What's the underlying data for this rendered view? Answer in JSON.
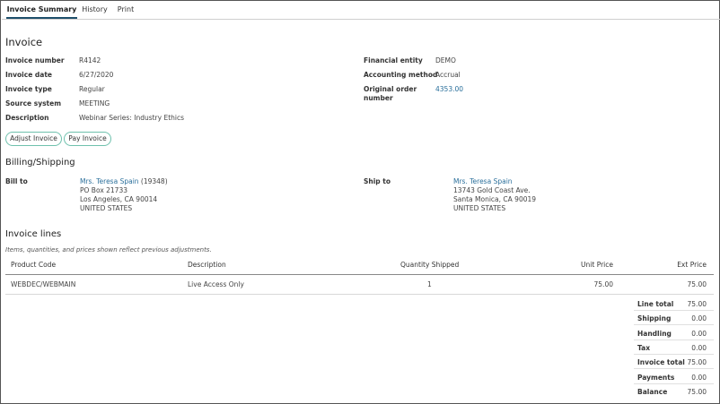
{
  "tabs": [
    "Invoice Summary",
    "History",
    "Print"
  ],
  "invoice": {
    "heading": "Invoice",
    "left": [
      {
        "label": "Invoice number",
        "value": "R4142"
      },
      {
        "label": "Invoice date",
        "value": "6/27/2020"
      },
      {
        "label": "Invoice type",
        "value": "Regular"
      },
      {
        "label": "Source system",
        "value": "MEETING"
      },
      {
        "label": "Description",
        "value": "Webinar Series: Industry Ethics"
      }
    ],
    "right": [
      {
        "label": "Financial entity",
        "value": "DEMO"
      },
      {
        "label": "Accounting method",
        "value": "Accrual"
      },
      {
        "label": "Original order number",
        "value": "4353.00"
      }
    ],
    "buttons": {
      "adjust": "Adjust Invoice",
      "pay": "Pay Invoice"
    }
  },
  "billing": {
    "heading": "Billing/Shipping",
    "bill_to": {
      "label": "Bill to",
      "name": "Mrs. Teresa Spain",
      "id": "(19348)",
      "line1": "PO Box 21733",
      "line2": "Los Angeles, CA 90014",
      "line3": "UNITED STATES"
    },
    "ship_to": {
      "label": "Ship to",
      "name": "Mrs. Teresa Spain",
      "line1": "13743 Gold Coast Ave.",
      "line2": "Santa Monica, CA 90019",
      "line3": "UNITED STATES"
    }
  },
  "lines": {
    "heading": "Invoice lines",
    "note": "Items, quantities, and prices shown reflect previous adjustments.",
    "columns": [
      "Product Code",
      "Description",
      "Quantity Shipped",
      "Unit Price",
      "Ext Price"
    ],
    "rows": [
      {
        "code": "WEBDEC/WEBMAIN",
        "description": "Live Access Only",
        "qty": "1",
        "unit": "75.00",
        "ext": "75.00"
      }
    ]
  },
  "totals": [
    {
      "label": "Line total",
      "value": "75.00"
    },
    {
      "label": "Shipping",
      "value": "0.00"
    },
    {
      "label": "Handling",
      "value": "0.00"
    },
    {
      "label": "Tax",
      "value": "0.00"
    },
    {
      "label": "Invoice total",
      "value": "75.00"
    },
    {
      "label": "Payments",
      "value": "0.00"
    },
    {
      "label": "Balance",
      "value": "75.00"
    }
  ],
  "colors": {
    "accent": "#1e4f6b",
    "link": "#2a6f9b",
    "button_border": "#6fc1ad"
  }
}
